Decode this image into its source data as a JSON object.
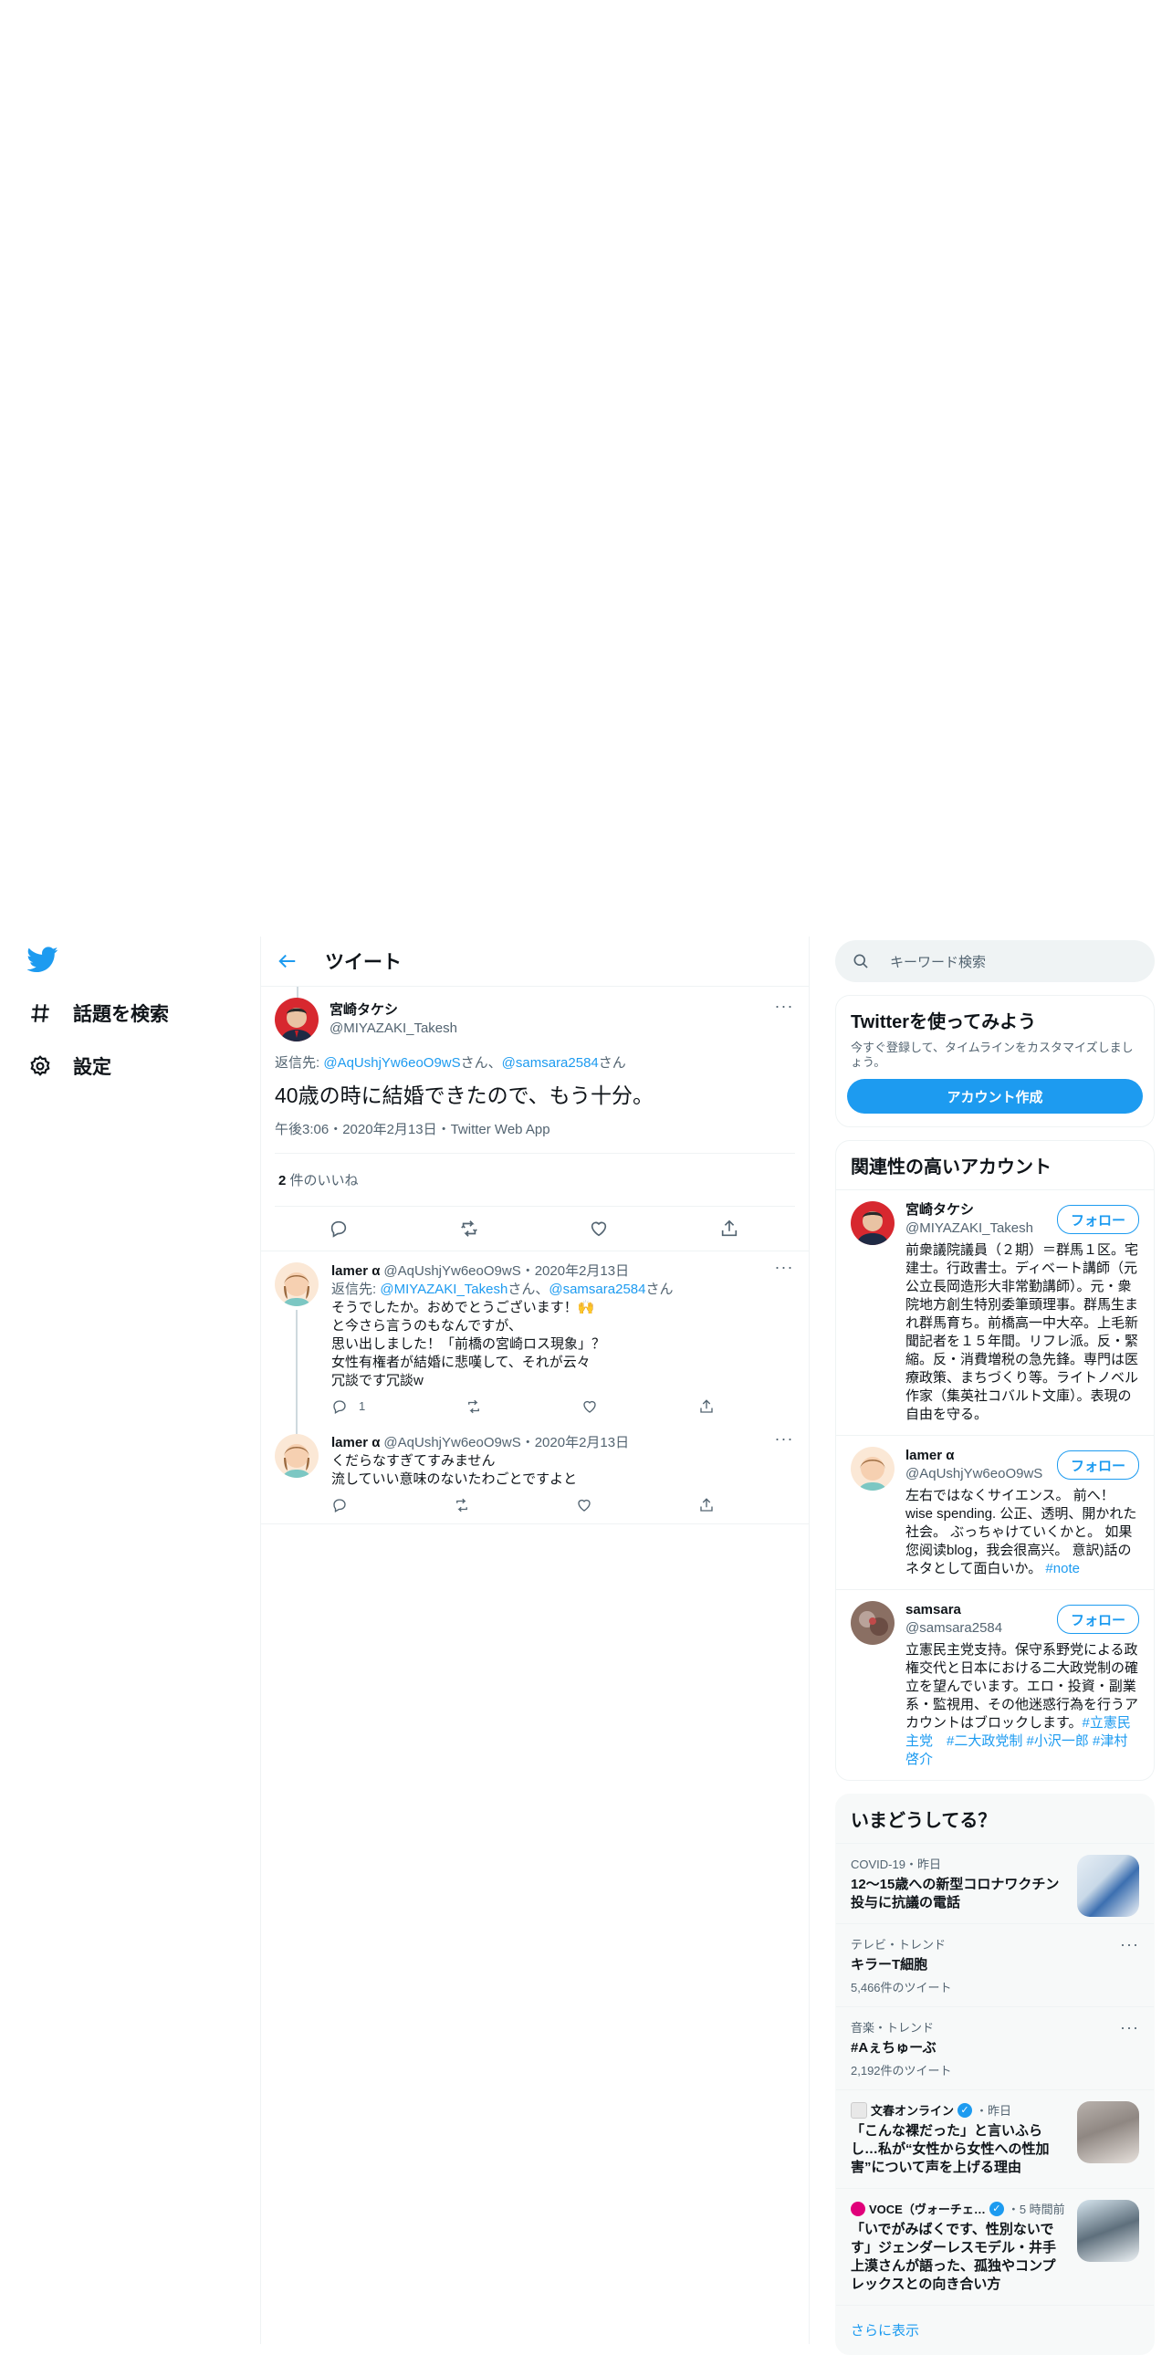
{
  "nav": {
    "items": [
      {
        "label": "話題を検索",
        "icon": "hashtag-icon"
      },
      {
        "label": "設定",
        "icon": "gear-icon"
      }
    ]
  },
  "header": {
    "title": "ツイート"
  },
  "focal_tweet": {
    "author_name": "宮崎タケシ",
    "author_handle": "@MIYAZAKI_Takesh",
    "reply_prefix": "返信先: ",
    "reply_user_1": "@AqUshjYw6eoO9wS",
    "reply_mid": "さん、",
    "reply_user_2": "@samsara2584",
    "reply_suffix": "さん",
    "text": "40歳の時に結婚できたので、もう十分。",
    "time": "午後3:06・2020年2月13日・Twitter Web App",
    "likes_count": "2",
    "likes_label": " 件のいいね"
  },
  "replies": [
    {
      "name": "lamer α",
      "handle": "@AqUshjYw6eoO9wS",
      "date": "・2020年2月13日",
      "reply_prefix": "返信先: ",
      "reply_user_1": "@MIYAZAKI_Takesh",
      "reply_mid": "さん、",
      "reply_user_2": "@samsara2584",
      "reply_suffix": "さん",
      "lines": [
        "そうでしたか。おめでとうございます！🙌",
        "と今さら言うのもなんですが、",
        "思い出しました！「前橋の宮崎ロス現象」？",
        "女性有権者が結婚に悲嘆して、それが云々",
        "冗談です冗談w"
      ],
      "reply_count": "1"
    },
    {
      "name": "lamer α",
      "handle": "@AqUshjYw6eoO9wS",
      "date": "・2020年2月13日",
      "lines": [
        "くだらなすぎてすみません",
        "流していい意味のないたわごとですよと"
      ]
    }
  ],
  "sidebar": {
    "search_placeholder": "キーワード検索",
    "signup": {
      "title": "Twitterを使ってみよう",
      "subtitle": "今すぐ登録して、タイムラインをカスタマイズしましょう。",
      "button": "アカウント作成"
    },
    "related": {
      "title": "関連性の高いアカウント",
      "follow_label": "フォロー",
      "accounts": [
        {
          "name": "宮崎タケシ",
          "handle": "@MIYAZAKI_Takesh",
          "bio": "前衆議院議員（２期）＝群馬１区。宅建士。行政書士。ディベート講師（元公立長岡造形大非常勤講師）。元・衆院地方創生特別委筆頭理事。群馬生まれ群馬育ち。前橋高一中大卒。上毛新聞記者を１５年間。リフレ派。反・緊縮。反・消費増税の急先鋒。専門は医療政策、まちづくり等。ライトノベル作家（集英社コバルト文庫）。表現の自由を守る。",
          "bio_tags": ""
        },
        {
          "name": "lamer α",
          "handle": "@AqUshjYw6eoO9wS",
          "bio": "左右ではなくサイエンス。 前へ！ wise spending. 公正、透明、開かれた社会。 ぶっちゃけていくかと。 如果您阅读blog，我会很高兴。 意訳)話のネタとして面白いか。 ",
          "bio_tags": "#note"
        },
        {
          "name": "samsara",
          "handle": "@samsara2584",
          "bio": "立憲民主党支持。保守系野党による政権交代と日本における二大政党制の確立を望んでいます。エロ・投資・副業系・監視用、その他迷惑行為を行うアカウントはブロックします。",
          "bio_tags": "#立憲民主党　#二大政党制 #小沢一郎 #津村啓介"
        }
      ]
    },
    "trends": {
      "title": "いまどうしてる？",
      "items": [
        {
          "context": "COVID-19・昨日",
          "title": "12～15歳への新型コロナワクチン投与に抗議の電話",
          "count": "",
          "thumb": true
        },
        {
          "context": "テレビ・トレンド",
          "title": "キラーT細胞",
          "count": "5,466件のツイート",
          "thumb": false
        },
        {
          "context": "音楽・トレンド",
          "title": "#Aぇちゅーぶ",
          "count": "2,192件のツイート",
          "thumb": false
        },
        {
          "context_src": "文春オンライン",
          "context_time": "・昨日",
          "title": "「こんな裸だった」と言いふらし…私が“女性から女性への性加害”について声を上げる理由",
          "count": "",
          "thumb": true
        },
        {
          "context_src": "VOCE（ヴォーチェ…",
          "context_time": "・5 時間前",
          "title": "「いでがみばくです、性別ないです」ジェンダーレスモデル・井手上漠さんが語った、孤独やコンプレックスとの向き合い方",
          "count": "",
          "thumb": true
        }
      ],
      "show_more": "さらに表示"
    }
  },
  "colors": {
    "accent": "#1d9bf0",
    "muted": "#536471",
    "border": "#eff3f4"
  }
}
